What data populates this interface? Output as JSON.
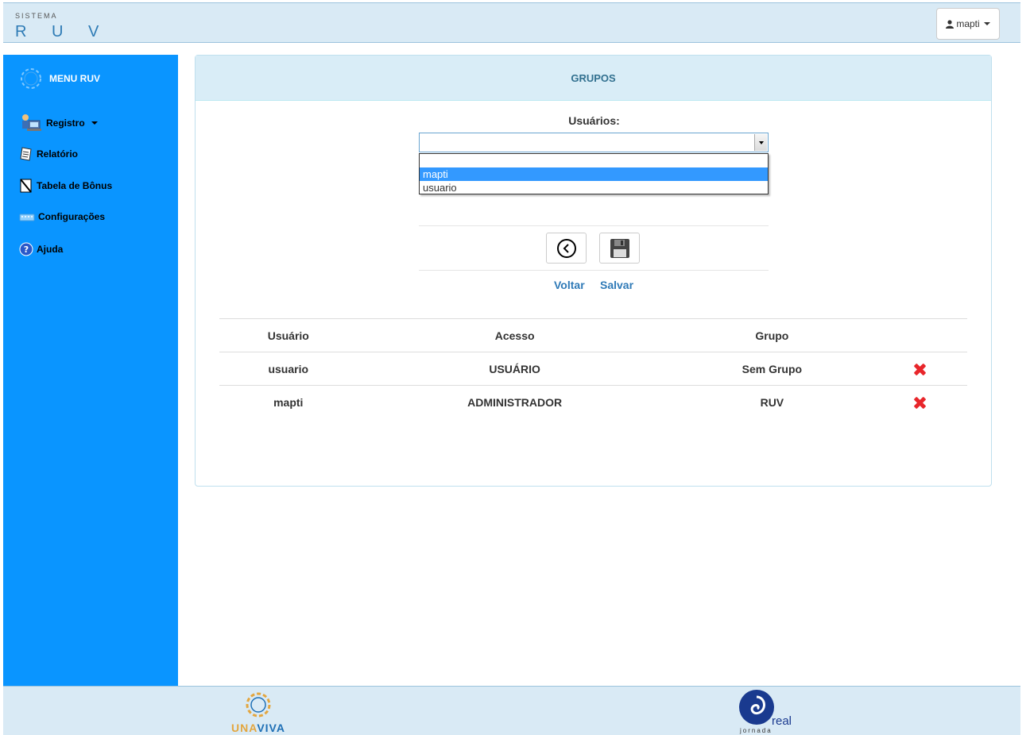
{
  "header": {
    "brand_small": "SISTEMA",
    "brand_big": "R U V",
    "user_label": "mapti"
  },
  "sidebar": {
    "menu_title": "MENU RUV",
    "items": [
      {
        "label": "Registro",
        "icon": "user-computer-icon"
      },
      {
        "label": "Relatório",
        "icon": "report-icon"
      },
      {
        "label": "Tabela de Bônus",
        "icon": "table-icon"
      },
      {
        "label": "Configurações",
        "icon": "keyboard-icon"
      },
      {
        "label": "Ajuda",
        "icon": "help-icon"
      }
    ]
  },
  "panel": {
    "title": "GRUPOS",
    "field_label": "Usuários:",
    "select_value": "",
    "options": [
      "mapti",
      "usuario"
    ],
    "selected_option": "mapti",
    "back_label": "Voltar",
    "save_label": "Salvar"
  },
  "table": {
    "headers": [
      "Usuário",
      "Acesso",
      "Grupo",
      ""
    ],
    "rows": [
      {
        "usuario": "usuario",
        "acesso": "USUÁRIO",
        "grupo": "Sem Grupo"
      },
      {
        "usuario": "mapti",
        "acesso": "ADMINISTRADOR",
        "grupo": "RUV"
      }
    ]
  },
  "footer": {
    "logo1_part1": "UNA",
    "logo1_part2": "VIVA",
    "logo2_main": "real",
    "logo2_sub": "jornada"
  },
  "colors": {
    "sidebar": "#0a95ff",
    "header_bg": "#d9eaf5",
    "panel_heading": "#d9edf7",
    "link": "#2f7ab7",
    "delete": "#e8262b"
  }
}
